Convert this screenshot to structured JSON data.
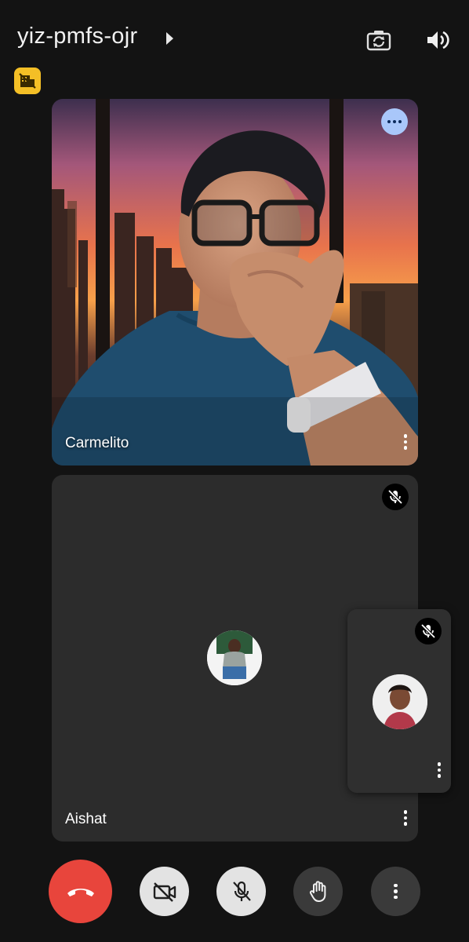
{
  "header": {
    "meeting_code": "yiz-pmfs-ojr"
  },
  "participants": [
    {
      "name": "Carmelito",
      "muted": false,
      "video_on": true
    },
    {
      "name": "Aishat",
      "muted": true,
      "video_on": false
    }
  ],
  "self_preview": {
    "muted": true,
    "video_on": false
  },
  "colors": {
    "background": "#131313",
    "tile": "#2c2c2c",
    "end_call": "#e8453c",
    "badge": "#f4bf26",
    "more_button": "#a9c7fa",
    "control_light": "#e3e3e3",
    "control_dark": "#3a3a3a"
  },
  "icons": {
    "header": [
      "arrow-right-icon",
      "switch-camera-icon",
      "speaker-icon",
      "no-sync-badge-icon"
    ],
    "controls": [
      "end-call-icon",
      "camera-off-icon",
      "mic-off-icon",
      "raise-hand-icon",
      "more-vert-icon"
    ]
  }
}
